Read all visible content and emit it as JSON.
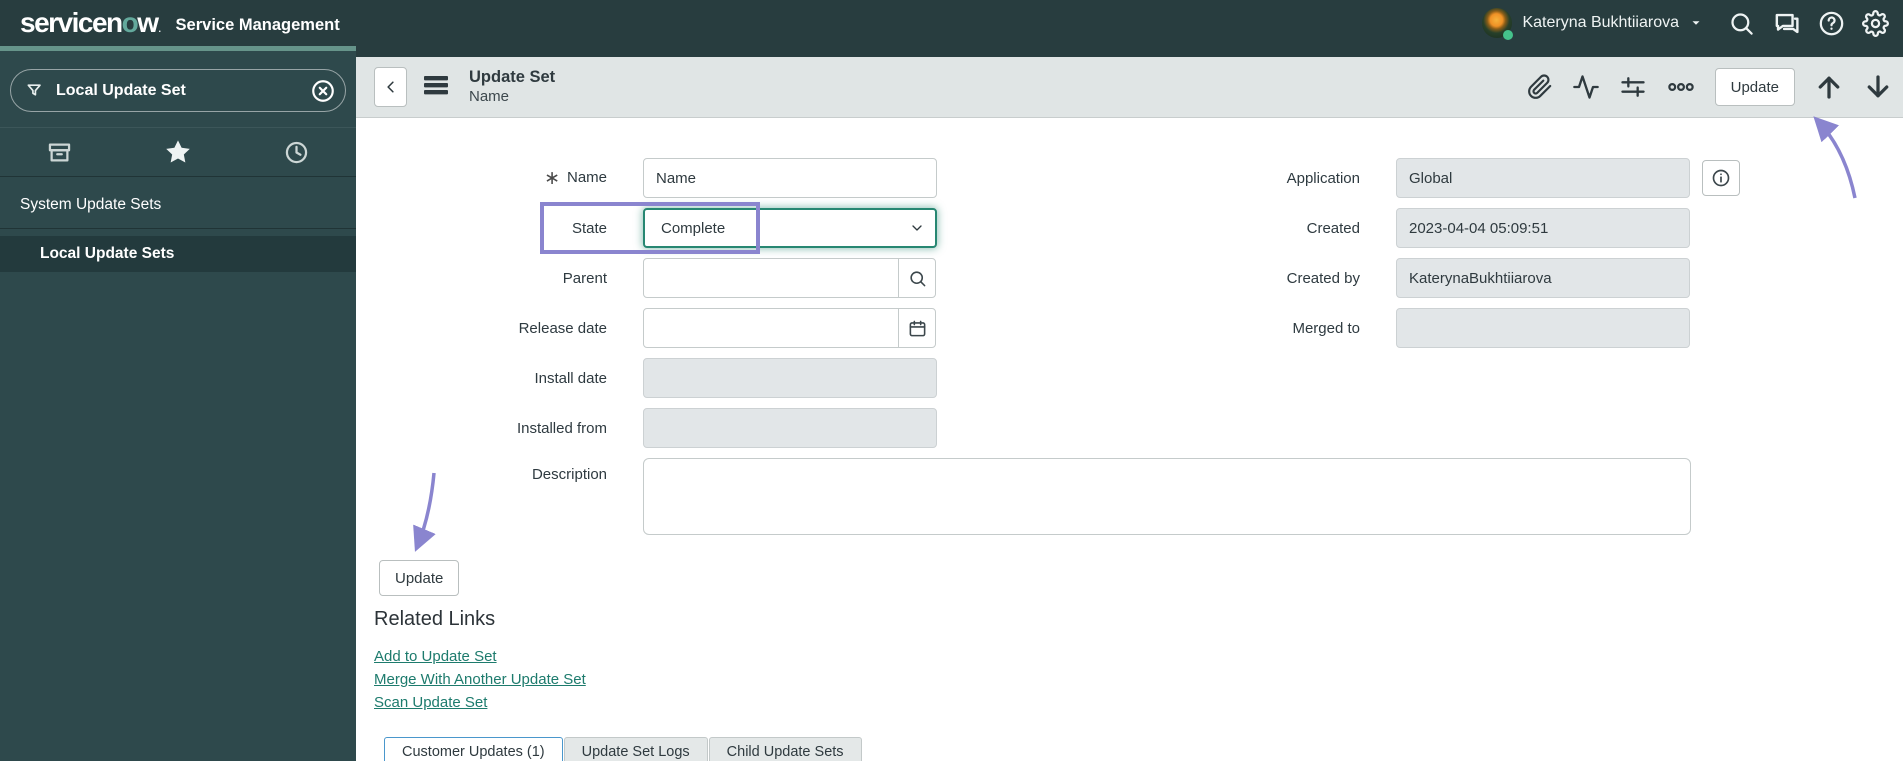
{
  "colors": {
    "banner_bg": "#283d3f",
    "sidebar_bg": "#2e494c",
    "sidebar_selected_bg": "#233a3d",
    "toolbar_bg": "#e0e5e5",
    "annotation_purple": "#8a85cf",
    "link_green": "#1d7b6d",
    "focus_green": "#278772",
    "logo_o_teal": "#63a99c"
  },
  "banner": {
    "logo_pre": "servicen",
    "logo_o": "o",
    "logo_post": "w",
    "logo_tm": ".",
    "app_label": "Service Management",
    "user_name": "Kateryna Bukhtiiarova"
  },
  "sidebar": {
    "filter_value": "Local Update Set",
    "section_label": "System Update Sets",
    "selected_item": "Local Update Sets"
  },
  "form_header": {
    "title": "Update Set",
    "subtitle": "Name",
    "update_button_label": "Update"
  },
  "form": {
    "name": {
      "label": "Name",
      "value": "Name"
    },
    "state": {
      "label": "State",
      "value": "Complete"
    },
    "parent": {
      "label": "Parent",
      "value": ""
    },
    "release_date": {
      "label": "Release date",
      "value": ""
    },
    "install_date": {
      "label": "Install date",
      "value": ""
    },
    "installed_from": {
      "label": "Installed from",
      "value": ""
    },
    "description": {
      "label": "Description",
      "value": ""
    },
    "application": {
      "label": "Application",
      "value": "Global"
    },
    "created": {
      "label": "Created",
      "value": "2023-04-04 05:09:51"
    },
    "created_by": {
      "label": "Created by",
      "value": "KaterynaBukhtiiarova"
    },
    "merged_to": {
      "label": "Merged to",
      "value": ""
    },
    "update_button_label": "Update"
  },
  "related_links": {
    "heading": "Related Links",
    "links": [
      "Add to Update Set",
      "Merge With Another Update Set",
      "Scan Update Set"
    ]
  },
  "tabs": [
    {
      "label": "Customer Updates (1)",
      "active": true
    },
    {
      "label": "Update Set Logs",
      "active": false
    },
    {
      "label": "Child Update Sets",
      "active": false
    }
  ]
}
